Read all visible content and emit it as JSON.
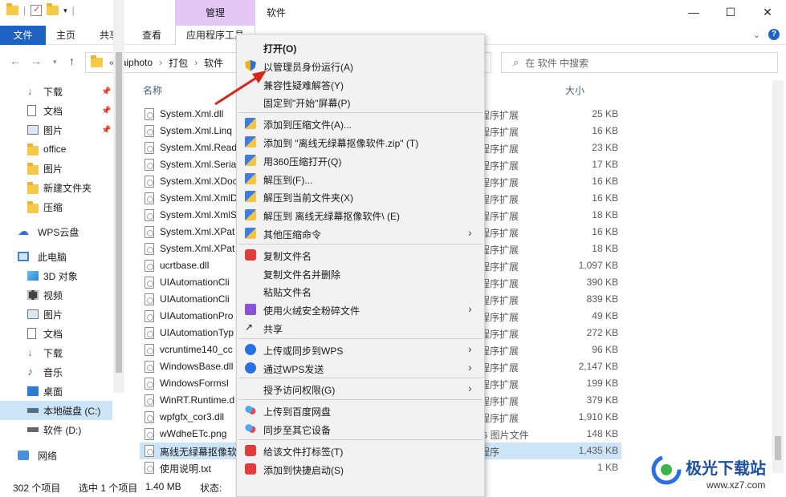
{
  "window": {
    "title": "软件",
    "tool_tab_header": "管理",
    "controls": {
      "minimize": "—",
      "maximize": "☐",
      "close": "✕"
    }
  },
  "ribbon": {
    "tabs": [
      "文件",
      "主页",
      "共享",
      "查看",
      "应用程序工具"
    ]
  },
  "address": {
    "path": [
      "«",
      "aiphoto",
      "›",
      "打包",
      "›",
      "软件"
    ],
    "search_placeholder": "在 软件 中搜索"
  },
  "sidebar": {
    "items": [
      {
        "label": "下载",
        "pinned": true,
        "icon": "download-icon"
      },
      {
        "label": "文档",
        "pinned": true,
        "icon": "document-icon"
      },
      {
        "label": "图片",
        "pinned": true,
        "icon": "picture-icon"
      },
      {
        "label": "office",
        "icon": "folder-icon"
      },
      {
        "label": "图片",
        "icon": "folder-icon"
      },
      {
        "label": "新建文件夹",
        "icon": "folder-icon"
      },
      {
        "label": "压缩",
        "icon": "folder-icon"
      },
      {
        "label": "WPS云盘",
        "icon": "cloud-icon"
      },
      {
        "label": "此电脑",
        "icon": "computer-icon"
      },
      {
        "label": "3D 对象",
        "icon": "3d-objects-icon"
      },
      {
        "label": "视频",
        "icon": "video-icon"
      },
      {
        "label": "图片",
        "icon": "picture-icon"
      },
      {
        "label": "文档",
        "icon": "document-icon"
      },
      {
        "label": "下载",
        "icon": "download-icon"
      },
      {
        "label": "音乐",
        "icon": "music-icon"
      },
      {
        "label": "桌面",
        "icon": "desktop-icon"
      },
      {
        "label": "本地磁盘 (C:)",
        "icon": "drive-icon"
      },
      {
        "label": "软件 (D:)",
        "icon": "drive-icon"
      },
      {
        "label": "网络",
        "icon": "network-icon"
      }
    ]
  },
  "filelist": {
    "headers": {
      "name": "名称",
      "size": "大小"
    },
    "rows": [
      {
        "name": "System.Xml.dll",
        "type": "程序扩展",
        "size": "25 KB"
      },
      {
        "name": "System.Xml.Linq",
        "type": "程序扩展",
        "size": "16 KB"
      },
      {
        "name": "System.Xml.Read",
        "type": "程序扩展",
        "size": "23 KB"
      },
      {
        "name": "System.Xml.Seria",
        "type": "程序扩展",
        "size": "17 KB"
      },
      {
        "name": "System.Xml.XDoc",
        "type": "程序扩展",
        "size": "16 KB"
      },
      {
        "name": "System.Xml.XmlD",
        "type": "程序扩展",
        "size": "16 KB"
      },
      {
        "name": "System.Xml.XmlS",
        "type": "程序扩展",
        "size": "18 KB"
      },
      {
        "name": "System.Xml.XPat",
        "type": "程序扩展",
        "size": "16 KB"
      },
      {
        "name": "System.Xml.XPat",
        "type": "程序扩展",
        "size": "18 KB"
      },
      {
        "name": "ucrtbase.dll",
        "type": "程序扩展",
        "size": "1,097 KB"
      },
      {
        "name": "UIAutomationCli",
        "type": "程序扩展",
        "size": "390 KB"
      },
      {
        "name": "UIAutomationCli",
        "type": "程序扩展",
        "size": "839 KB"
      },
      {
        "name": "UIAutomationPro",
        "type": "程序扩展",
        "size": "49 KB"
      },
      {
        "name": "UIAutomationTyp",
        "type": "程序扩展",
        "size": "272 KB"
      },
      {
        "name": "vcruntime140_cc",
        "type": "程序扩展",
        "size": "96 KB"
      },
      {
        "name": "WindowsBase.dll",
        "type": "程序扩展",
        "size": "2,147 KB"
      },
      {
        "name": "WindowsFormsI",
        "type": "程序扩展",
        "size": "199 KB"
      },
      {
        "name": "WinRT.Runtime.d",
        "type": "程序扩展",
        "size": "379 KB"
      },
      {
        "name": "wpfgfx_cor3.dll",
        "type": "程序扩展",
        "size": "1,910 KB"
      },
      {
        "name": "wWdheETc.png",
        "type": "G 图片文件",
        "size": "148 KB"
      },
      {
        "name": "离线无绿幕抠像软",
        "type": "程序",
        "size": "1,435 KB",
        "selected": true
      },
      {
        "name": "使用说明.txt",
        "type": "",
        "size": "1 KB"
      }
    ]
  },
  "status": {
    "count": "302 个项目",
    "selected": "选中 1 个项目",
    "size": "1.40 MB",
    "state": "状态:"
  },
  "context_menu": {
    "items": [
      {
        "label": "打开(O)",
        "bold": true,
        "icon": ""
      },
      {
        "label": "以管理员身份运行(A)",
        "icon": "shield-icon"
      },
      {
        "label": "兼容性疑难解答(Y)",
        "icon": ""
      },
      {
        "label": "固定到\"开始\"屏幕(P)",
        "icon": ""
      },
      {
        "sep": true
      },
      {
        "label": "添加到压缩文件(A)...",
        "icon": "zip-icon"
      },
      {
        "label": "添加到 \"离线无绿幕抠像软件.zip\" (T)",
        "icon": "zip-icon"
      },
      {
        "label": "用360压缩打开(Q)",
        "icon": "zip-icon"
      },
      {
        "label": "解压到(F)...",
        "icon": "zip-icon"
      },
      {
        "label": "解压到当前文件夹(X)",
        "icon": "zip-icon"
      },
      {
        "label": "解压到 离线无绿幕抠像软件\\ (E)",
        "icon": "zip-icon"
      },
      {
        "label": "其他压缩命令",
        "icon": "zip-icon",
        "submenu": true
      },
      {
        "sep": true
      },
      {
        "label": "复制文件名",
        "icon": "copy-name-icon"
      },
      {
        "label": "复制文件名并删除",
        "icon": ""
      },
      {
        "label": "粘贴文件名",
        "icon": ""
      },
      {
        "label": "使用火绒安全粉碎文件",
        "icon": "shredder-icon",
        "submenu": true
      },
      {
        "label": "共享",
        "icon": "share-icon"
      },
      {
        "sep": true
      },
      {
        "label": "上传或同步到WPS",
        "icon": "wps-upload-icon",
        "submenu": true
      },
      {
        "label": "通过WPS发送",
        "icon": "wps-send-icon",
        "submenu": true
      },
      {
        "sep": true
      },
      {
        "label": "授予访问权限(G)",
        "icon": "",
        "submenu": true
      },
      {
        "sep": true
      },
      {
        "label": "上传到百度网盘",
        "icon": "baidu-icon"
      },
      {
        "label": "同步至其它设备",
        "icon": "baidu-icon"
      },
      {
        "sep": true
      },
      {
        "label": "给该文件打标签(T)",
        "icon": "tag-icon"
      },
      {
        "label": "添加到快捷启动(S)",
        "icon": "quicklaunch-icon"
      }
    ]
  },
  "watermark": {
    "name": "极光下载站",
    "url": "www.xz7.com"
  },
  "colors": {
    "accent": "#1e63c4",
    "tool_tab": "#e5c7f5",
    "selection": "#cce4f7",
    "annotation": "#d9251c"
  }
}
